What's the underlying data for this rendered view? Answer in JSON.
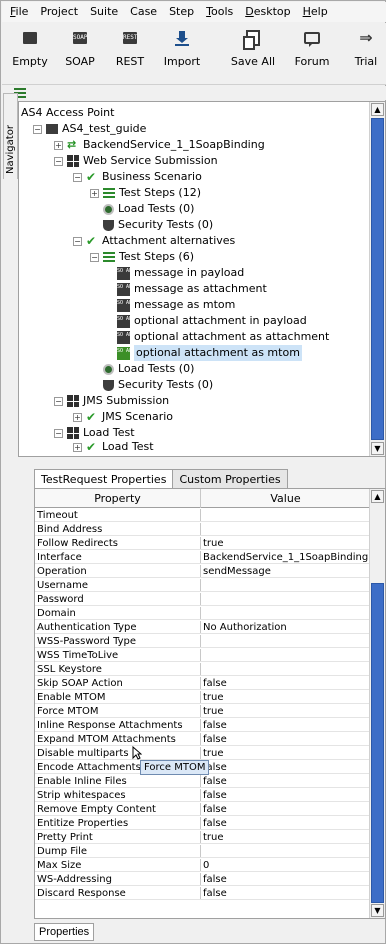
{
  "menu": [
    {
      "label": "File",
      "u": "F",
      "rest": "ile"
    },
    {
      "label": "Project",
      "u": "",
      "rest": "Project"
    },
    {
      "label": "Suite",
      "u": "",
      "rest": "Suite"
    },
    {
      "label": "Case",
      "u": "",
      "rest": "Case"
    },
    {
      "label": "Step",
      "u": "",
      "rest": "Step"
    },
    {
      "label": "Tools",
      "u": "T",
      "rest": "ools"
    },
    {
      "label": "Desktop",
      "u": "D",
      "rest": "esktop"
    },
    {
      "label": "Help",
      "u": "H",
      "rest": "elp"
    }
  ],
  "toolbar": {
    "empty": "Empty",
    "soap": "SOAP",
    "rest": "REST",
    "import": "Import",
    "save_all": "Save All",
    "forum": "Forum",
    "trial": "Trial",
    "soap_icon_text": "SOAP",
    "rest_icon_text": "REST"
  },
  "navigator": "Navigator",
  "tree": {
    "root": "AS4 Access Point",
    "project": "AS4_test_guide",
    "binding": "BackendService_1_1SoapBinding",
    "suite": "Web Service Submission",
    "case1": "Business Scenario",
    "case1_steps": "Test Steps (12)",
    "case1_load": "Load Tests (0)",
    "case1_sec": "Security Tests (0)",
    "case2": "Attachment alternatives",
    "case2_steps": "Test Steps (6)",
    "steps": [
      "message in payload",
      "message as attachment",
      "message as mtom",
      "optional attachment in payload",
      "optional attachment as attachment",
      "optional attachment as mtom"
    ],
    "case2_load": "Load Tests (0)",
    "case2_sec": "Security Tests (0)",
    "jms": "JMS Submission",
    "jms_scenario": "JMS Scenario",
    "load_test": "Load Test",
    "load_test_child": "Load Test"
  },
  "tabs": {
    "testrequest": "TestRequest Properties",
    "custom": "Custom Properties"
  },
  "table": {
    "col_property": "Property",
    "col_value": "Value",
    "rows": [
      [
        "Timeout",
        ""
      ],
      [
        "Bind Address",
        ""
      ],
      [
        "Follow Redirects",
        "true"
      ],
      [
        "Interface",
        "BackendService_1_1SoapBinding"
      ],
      [
        "Operation",
        "sendMessage"
      ],
      [
        "Username",
        ""
      ],
      [
        "Password",
        ""
      ],
      [
        "Domain",
        ""
      ],
      [
        "Authentication Type",
        "No Authorization"
      ],
      [
        "WSS-Password Type",
        ""
      ],
      [
        "WSS TimeToLive",
        ""
      ],
      [
        "SSL Keystore",
        ""
      ],
      [
        "Skip SOAP Action",
        "false"
      ],
      [
        "Enable MTOM",
        "true"
      ],
      [
        "Force MTOM",
        "true"
      ],
      [
        "Inline Response Attachments",
        "false"
      ],
      [
        "Expand MTOM Attachments",
        "false"
      ],
      [
        "Disable multiparts",
        "true"
      ],
      [
        "Encode Attachments",
        "false"
      ],
      [
        "Enable Inline Files",
        "false"
      ],
      [
        "Strip whitespaces",
        "false"
      ],
      [
        "Remove Empty Content",
        "false"
      ],
      [
        "Entitize Properties",
        "false"
      ],
      [
        "Pretty Print",
        "true"
      ],
      [
        "Dump File",
        ""
      ],
      [
        "Max Size",
        "0"
      ],
      [
        "WS-Addressing",
        "false"
      ],
      [
        "Discard Response",
        "false"
      ]
    ]
  },
  "tooltip": "Force MTOM",
  "properties_button": "Properties",
  "colors": {
    "selection": "#cde3f7",
    "scroll_thumb": "#3c6dc7",
    "check_green": "#2a9a2a"
  }
}
